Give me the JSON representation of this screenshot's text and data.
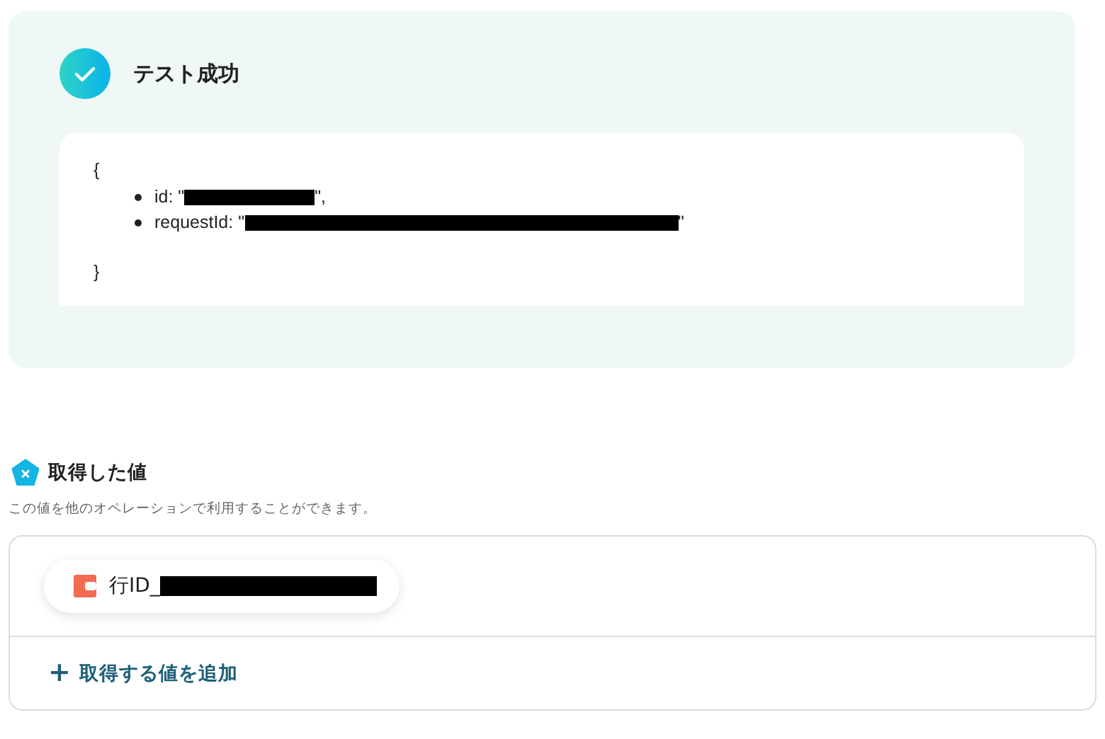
{
  "test_result": {
    "title": "テスト成功",
    "open_brace": "{",
    "close_brace": "}",
    "fields": [
      {
        "prefix": "id: \"",
        "suffix": "\","
      },
      {
        "prefix": "requestId: \"",
        "suffix": "\""
      }
    ]
  },
  "obtained_values": {
    "title": "取得した値",
    "description": "この値を他のオペレーションで利用することができます。",
    "values": [
      {
        "label": "行ID_"
      }
    ],
    "add_button": {
      "icon": "+",
      "label": "取得する値を追加"
    }
  }
}
